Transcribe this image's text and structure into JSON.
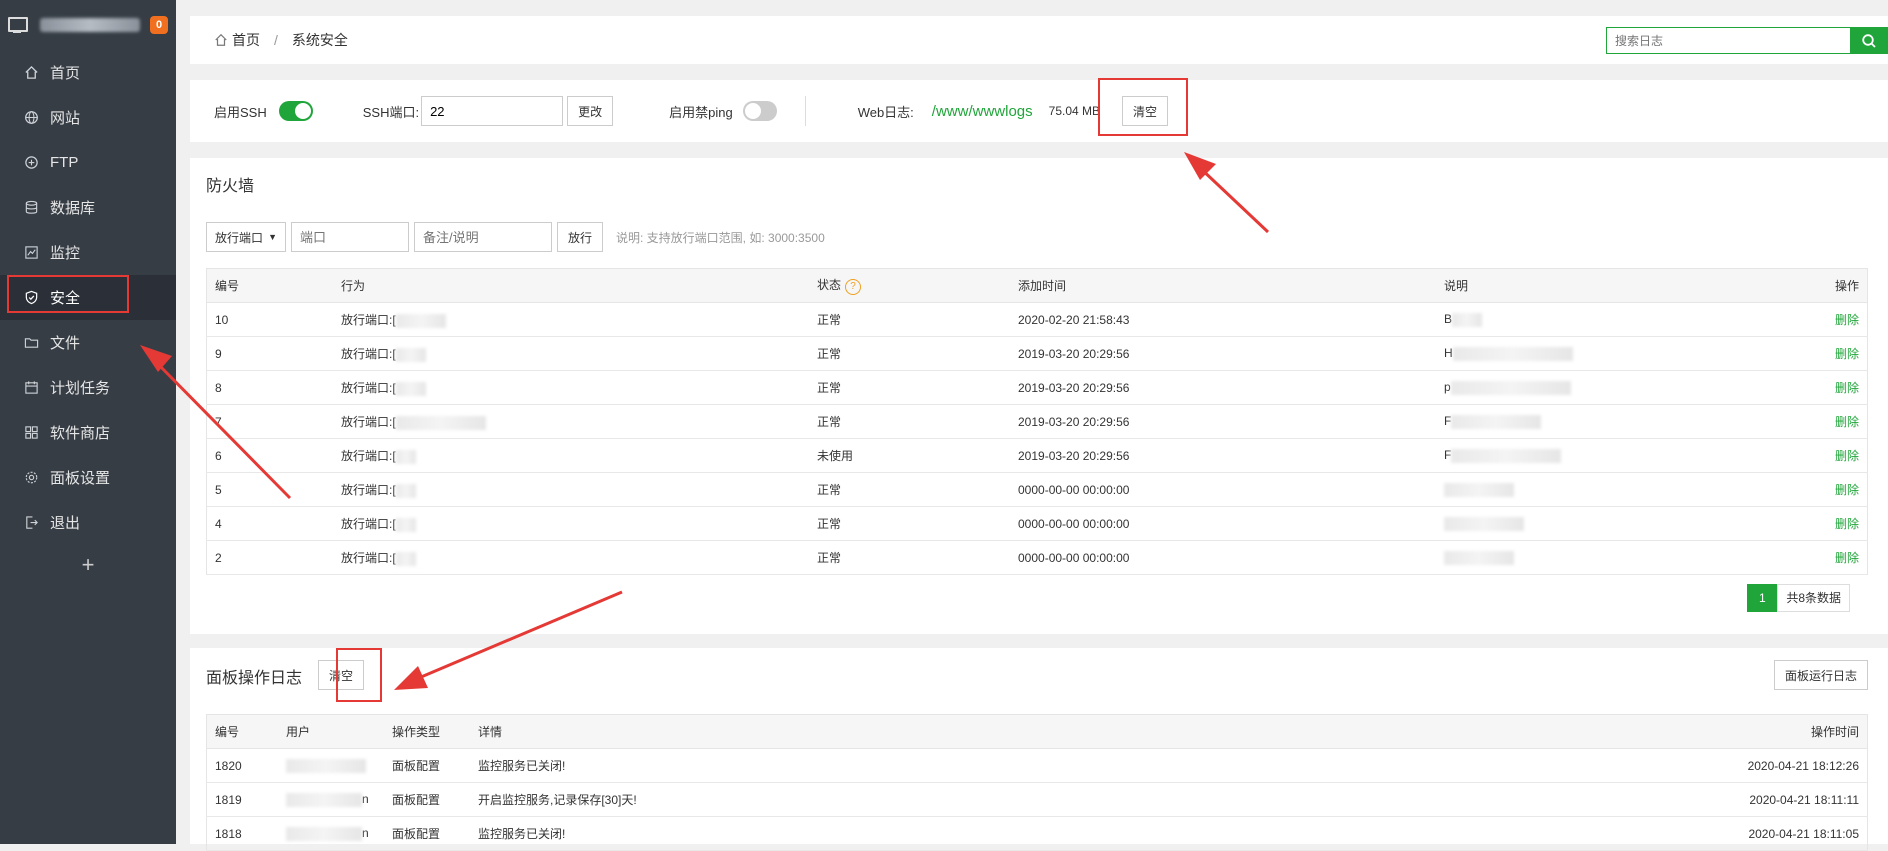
{
  "sidebar": {
    "badge": "0",
    "items": [
      {
        "label": "首页",
        "icon": "home-icon"
      },
      {
        "label": "网站",
        "icon": "globe-icon"
      },
      {
        "label": "FTP",
        "icon": "ftp-icon"
      },
      {
        "label": "数据库",
        "icon": "database-icon"
      },
      {
        "label": "监控",
        "icon": "monitor-chart-icon"
      },
      {
        "label": "安全",
        "icon": "shield-icon"
      },
      {
        "label": "文件",
        "icon": "folder-icon"
      },
      {
        "label": "计划任务",
        "icon": "calendar-icon"
      },
      {
        "label": "软件商店",
        "icon": "apps-grid-icon"
      },
      {
        "label": "面板设置",
        "icon": "gear-icon"
      },
      {
        "label": "退出",
        "icon": "logout-icon"
      }
    ],
    "add_label": "+"
  },
  "breadcrumb": {
    "home": "首页",
    "sep": "/",
    "current": "系统安全"
  },
  "search": {
    "placeholder": "搜索日志"
  },
  "toolbar": {
    "ssh_label": "启用SSH",
    "ssh_port_label": "SSH端口:",
    "ssh_port_value": "22",
    "change_label": "更改",
    "ping_label": "启用禁ping",
    "weblog_label": "Web日志:",
    "weblog_path": "/www/wwwlogs",
    "weblog_size": "75.04 MB",
    "clear_label": "清空"
  },
  "firewall": {
    "title": "防火墙",
    "select_value": "放行端口",
    "port_placeholder": "端口",
    "note_placeholder": "备注/说明",
    "allow_label": "放行",
    "hint": "说明: 支持放行端口范围, 如: 3000:3500",
    "headers": [
      "编号",
      "行为",
      "状态",
      "添加时间",
      "说明",
      "操作"
    ],
    "rows": [
      {
        "id": "10",
        "action": "放行端口:[",
        "status": "正常",
        "time": "2020-02-20 21:58:43",
        "note": "B",
        "op": "删除"
      },
      {
        "id": "9",
        "action": "放行端口:[",
        "status": "正常",
        "time": "2019-03-20 20:29:56",
        "note": "H",
        "op": "删除"
      },
      {
        "id": "8",
        "action": "放行端口:[",
        "status": "正常",
        "time": "2019-03-20 20:29:56",
        "note": "p",
        "op": "删除"
      },
      {
        "id": "7",
        "action": "放行端口:[",
        "status": "正常",
        "time": "2019-03-20 20:29:56",
        "note": "F",
        "op": "删除"
      },
      {
        "id": "6",
        "action": "放行端口:[",
        "status": "未使用",
        "time": "2019-03-20 20:29:56",
        "note": "F",
        "op": "删除"
      },
      {
        "id": "5",
        "action": "放行端口:[",
        "status": "正常",
        "time": "0000-00-00 00:00:00",
        "note": "",
        "op": "删除"
      },
      {
        "id": "4",
        "action": "放行端口:[",
        "status": "正常",
        "time": "0000-00-00 00:00:00",
        "note": "",
        "op": "删除"
      },
      {
        "id": "2",
        "action": "放行端口:[",
        "status": "正常",
        "time": "0000-00-00 00:00:00",
        "note": "",
        "op": "删除"
      }
    ],
    "page": "1",
    "total": "共8条数据"
  },
  "logs": {
    "title": "面板操作日志",
    "clear_label": "清空",
    "run_log_label": "面板运行日志",
    "headers": [
      "编号",
      "用户",
      "操作类型",
      "详情",
      "操作时间"
    ],
    "rows": [
      {
        "id": "1820",
        "user": "",
        "type": "面板配置",
        "detail": "监控服务已关闭!",
        "time": "2020-04-21 18:12:26"
      },
      {
        "id": "1819",
        "user": "n",
        "type": "面板配置",
        "detail": "开启监控服务,记录保存[30]天!",
        "time": "2020-04-21 18:11:11"
      },
      {
        "id": "1818",
        "user": "n",
        "type": "面板配置",
        "detail": "监控服务已关闭!",
        "time": "2020-04-21 18:11:05"
      }
    ]
  },
  "colors": {
    "accent": "#20a53a",
    "sidebar": "#363d45",
    "annotation": "#e53935",
    "badge": "#f07020"
  }
}
